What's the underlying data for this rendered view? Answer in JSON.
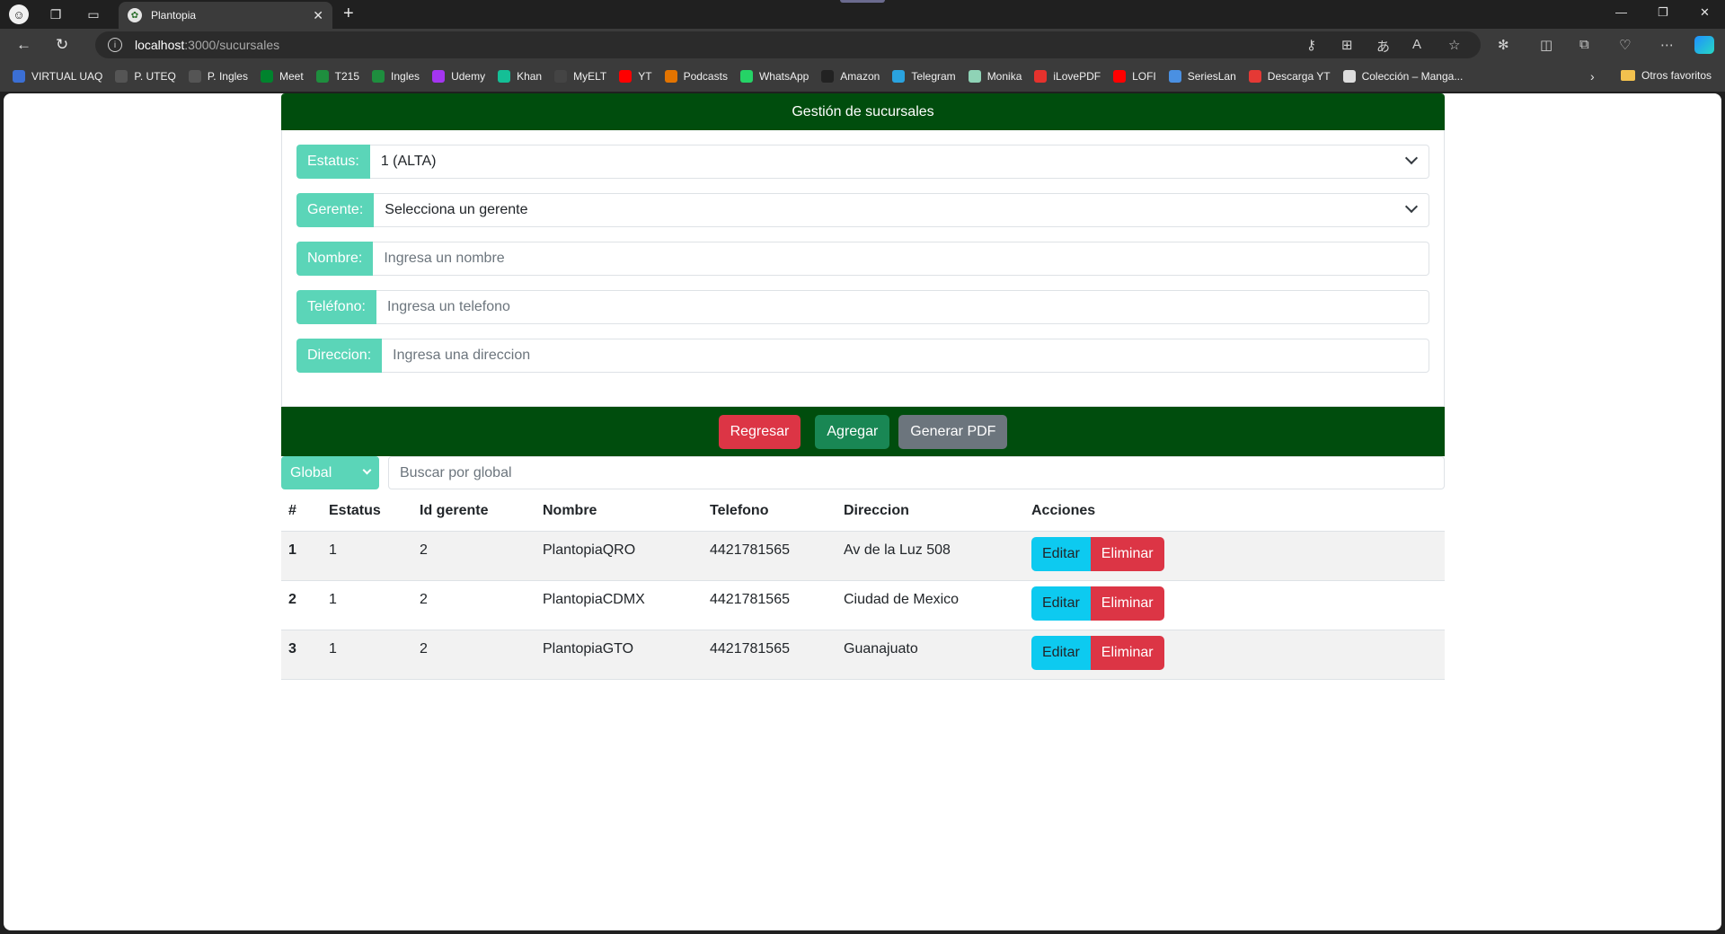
{
  "browser": {
    "tab_title": "Plantopia",
    "url_host": "localhost",
    "url_path": ":3000/sucursales",
    "bookmarks": [
      {
        "label": "VIRTUAL UAQ",
        "icon": "uaq-icon",
        "color": "#3b6fd4"
      },
      {
        "label": "P. UTEQ",
        "icon": "page-icon",
        "color": "#555555"
      },
      {
        "label": "P. Ingles",
        "icon": "page-icon",
        "color": "#555555"
      },
      {
        "label": "Meet",
        "icon": "meet-icon",
        "color": "#00832d"
      },
      {
        "label": "T215",
        "icon": "classroom-icon",
        "color": "#1e8e3e"
      },
      {
        "label": "Ingles",
        "icon": "classroom-icon",
        "color": "#1e8e3e"
      },
      {
        "label": "Udemy",
        "icon": "udemy-icon",
        "color": "#a435f0"
      },
      {
        "label": "Khan",
        "icon": "khan-icon",
        "color": "#14bf96"
      },
      {
        "label": "MyELT",
        "icon": "myelt-icon",
        "color": "#444444"
      },
      {
        "label": "YT",
        "icon": "youtube-icon",
        "color": "#ff0000"
      },
      {
        "label": "Podcasts",
        "icon": "podcasts-icon",
        "color": "#e37400"
      },
      {
        "label": "WhatsApp",
        "icon": "whatsapp-icon",
        "color": "#25d366"
      },
      {
        "label": "Amazon",
        "icon": "amazon-icon",
        "color": "#222222"
      },
      {
        "label": "Telegram",
        "icon": "telegram-icon",
        "color": "#2aa3df"
      },
      {
        "label": "Monika",
        "icon": "monika-icon",
        "color": "#8fd3b6"
      },
      {
        "label": "iLovePDF",
        "icon": "ilovepdf-icon",
        "color": "#e5322d"
      },
      {
        "label": "LOFI",
        "icon": "youtube-icon",
        "color": "#ff0000"
      },
      {
        "label": "SeriesLan",
        "icon": "serieslan-icon",
        "color": "#4a90e2"
      },
      {
        "label": "Descarga YT",
        "icon": "download-icon",
        "color": "#e53935"
      },
      {
        "label": "Colección – Manga...",
        "icon": "manga-icon",
        "color": "#dddddd"
      }
    ],
    "other_favorites": "Otros favoritos"
  },
  "app": {
    "header_title": "Gestión de sucursales",
    "form": {
      "status": {
        "label": "Estatus:",
        "value": "1 (ALTA)"
      },
      "manager": {
        "label": "Gerente:",
        "value": "Selecciona un gerente"
      },
      "name": {
        "label": "Nombre:",
        "placeholder": "Ingresa un nombre"
      },
      "phone": {
        "label": "Teléfono:",
        "placeholder": "Ingresa un telefono"
      },
      "address": {
        "label": "Direccion:",
        "placeholder": "Ingresa una direccion"
      }
    },
    "buttons": {
      "back": "Regresar",
      "add": "Agregar",
      "pdf": "Generar PDF"
    },
    "search": {
      "filter": "Global",
      "placeholder": "Buscar por global"
    },
    "table": {
      "headers": [
        "#",
        "Estatus",
        "Id gerente",
        "Nombre",
        "Telefono",
        "Direccion",
        "Acciones"
      ],
      "rows": [
        {
          "num": "1",
          "status": "1",
          "manager_id": "2",
          "name": "PlantopiaQRO",
          "phone": "4421781565",
          "address": "Av de la Luz 508"
        },
        {
          "num": "2",
          "status": "1",
          "manager_id": "2",
          "name": "PlantopiaCDMX",
          "phone": "4421781565",
          "address": "Ciudad de Mexico"
        },
        {
          "num": "3",
          "status": "1",
          "manager_id": "2",
          "name": "PlantopiaGTO",
          "phone": "4421781565",
          "address": "Guanajuato"
        }
      ],
      "edit_label": "Editar",
      "delete_label": "Eliminar"
    }
  },
  "colors": {
    "header_green": "#004d0d",
    "label_teal": "#5bd5b8",
    "danger": "#dc3545",
    "success": "#198754",
    "secondary": "#6c757d",
    "info": "#0dcaf0"
  }
}
